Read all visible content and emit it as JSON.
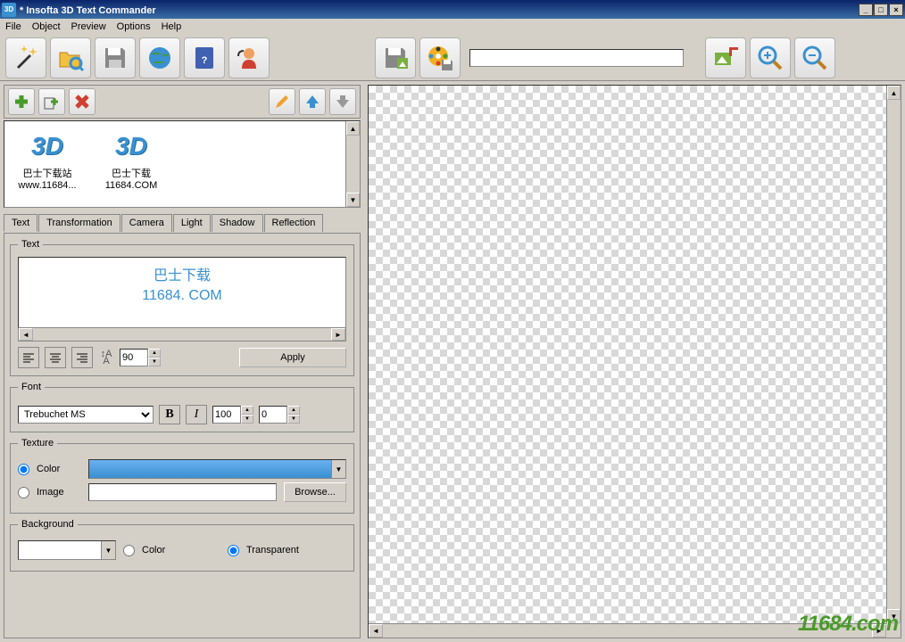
{
  "window": {
    "title": "Insofta 3D Text Commander",
    "title_prefix": "* "
  },
  "menu": {
    "file": "File",
    "object": "Object",
    "preview": "Preview",
    "options": "Options",
    "help": "Help"
  },
  "thumbnails": [
    {
      "label": "3D",
      "name": "巴士下载站",
      "url": "www.11684..."
    },
    {
      "label": "3D",
      "name": "巴士下载",
      "url": "11684.COM"
    }
  ],
  "tabs": {
    "text": "Text",
    "transformation": "Transformation",
    "camera": "Camera",
    "light": "Light",
    "shadow": "Shadow",
    "reflection": "Reflection"
  },
  "text_panel": {
    "group_label": "Text",
    "line1": "巴士下载",
    "line2": "11684. COM",
    "spacing": "90",
    "apply": "Apply"
  },
  "font_panel": {
    "group_label": "Font",
    "family": "Trebuchet MS",
    "bold": "B",
    "italic": "I",
    "size": "100",
    "extra": "0"
  },
  "texture_panel": {
    "group_label": "Texture",
    "color_label": "Color",
    "image_label": "Image",
    "browse": "Browse..."
  },
  "background_panel": {
    "group_label": "Background",
    "color_label": "Color",
    "transparent_label": "Transparent"
  },
  "watermark": "11684.com"
}
